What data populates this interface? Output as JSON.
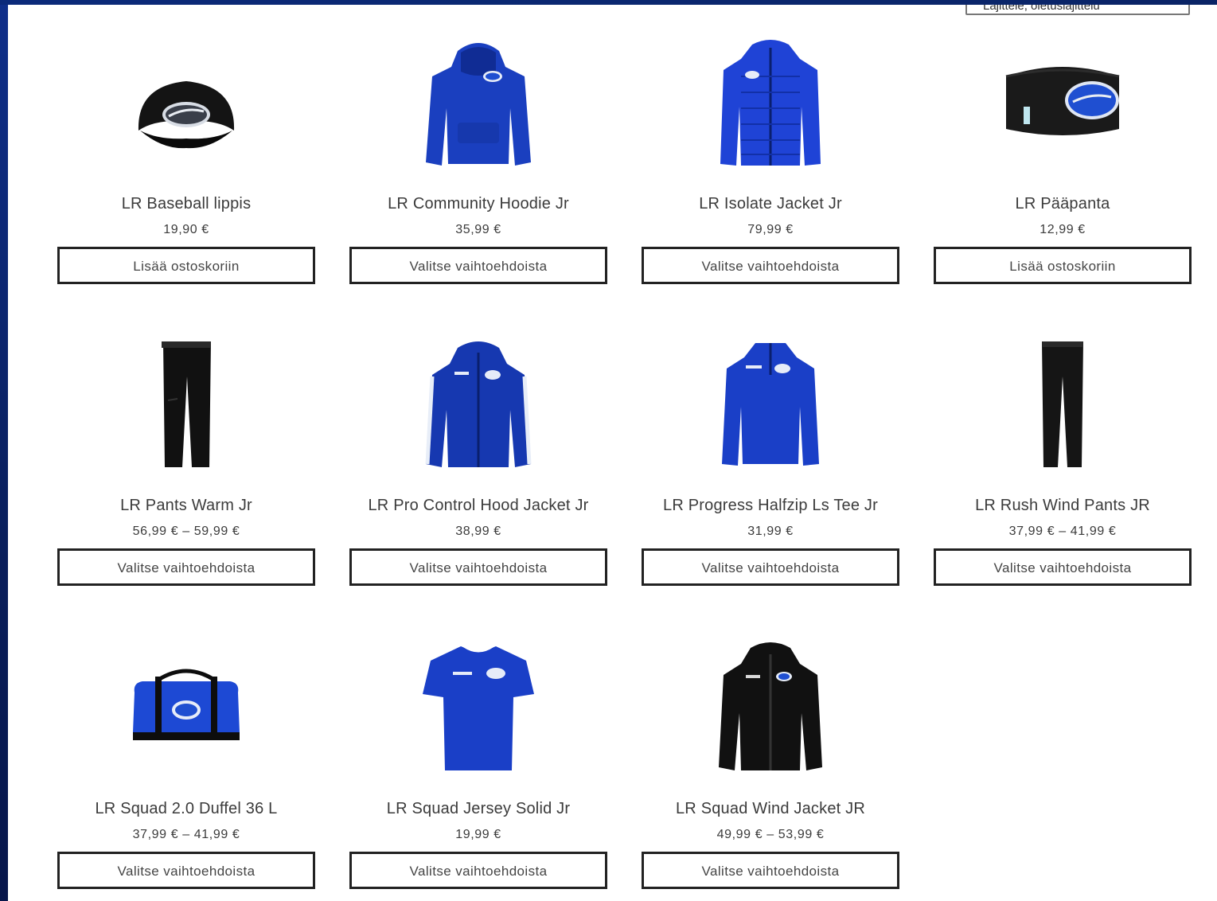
{
  "sort": {
    "selected": "Lajittele, oletuslajittelu"
  },
  "colors": {
    "brand_blue": "#1737b8",
    "frame_blue": "#0b2a7a",
    "button_border": "#222222"
  },
  "products": [
    {
      "name": "LR Baseball lippis",
      "price": "19,90 €",
      "button": "Lisää ostoskoriin",
      "icon": "baseball-cap-icon"
    },
    {
      "name": "LR Community Hoodie Jr",
      "price": "35,99 €",
      "button": "Valitse vaihtoehdoista",
      "icon": "hoodie-icon"
    },
    {
      "name": "LR Isolate Jacket Jr",
      "price": "79,99 €",
      "button": "Valitse vaihtoehdoista",
      "icon": "puffer-jacket-icon"
    },
    {
      "name": "LR Pääpanta",
      "price": "12,99 €",
      "button": "Lisää ostoskoriin",
      "icon": "headband-icon"
    },
    {
      "name": "LR Pants Warm Jr",
      "price": "56,99 € – 59,99 €",
      "button": "Valitse vaihtoehdoista",
      "icon": "pants-icon"
    },
    {
      "name": "LR Pro Control Hood Jacket Jr",
      "price": "38,99 €",
      "button": "Valitse vaihtoehdoista",
      "icon": "hood-jacket-icon"
    },
    {
      "name": "LR Progress Halfzip Ls Tee Jr",
      "price": "31,99 €",
      "button": "Valitse vaihtoehdoista",
      "icon": "halfzip-icon"
    },
    {
      "name": "LR Rush Wind Pants JR",
      "price": "37,99 € – 41,99 €",
      "button": "Valitse vaihtoehdoista",
      "icon": "wind-pants-icon"
    },
    {
      "name": "LR Squad 2.0 Duffel 36 L",
      "price": "37,99 € – 41,99 €",
      "button": "Valitse vaihtoehdoista",
      "icon": "duffel-bag-icon"
    },
    {
      "name": "LR Squad Jersey Solid Jr",
      "price": "19,99 €",
      "button": "Valitse vaihtoehdoista",
      "icon": "jersey-icon"
    },
    {
      "name": "LR Squad Wind Jacket JR",
      "price": "49,99 € – 53,99 €",
      "button": "Valitse vaihtoehdoista",
      "icon": "wind-jacket-icon"
    }
  ]
}
